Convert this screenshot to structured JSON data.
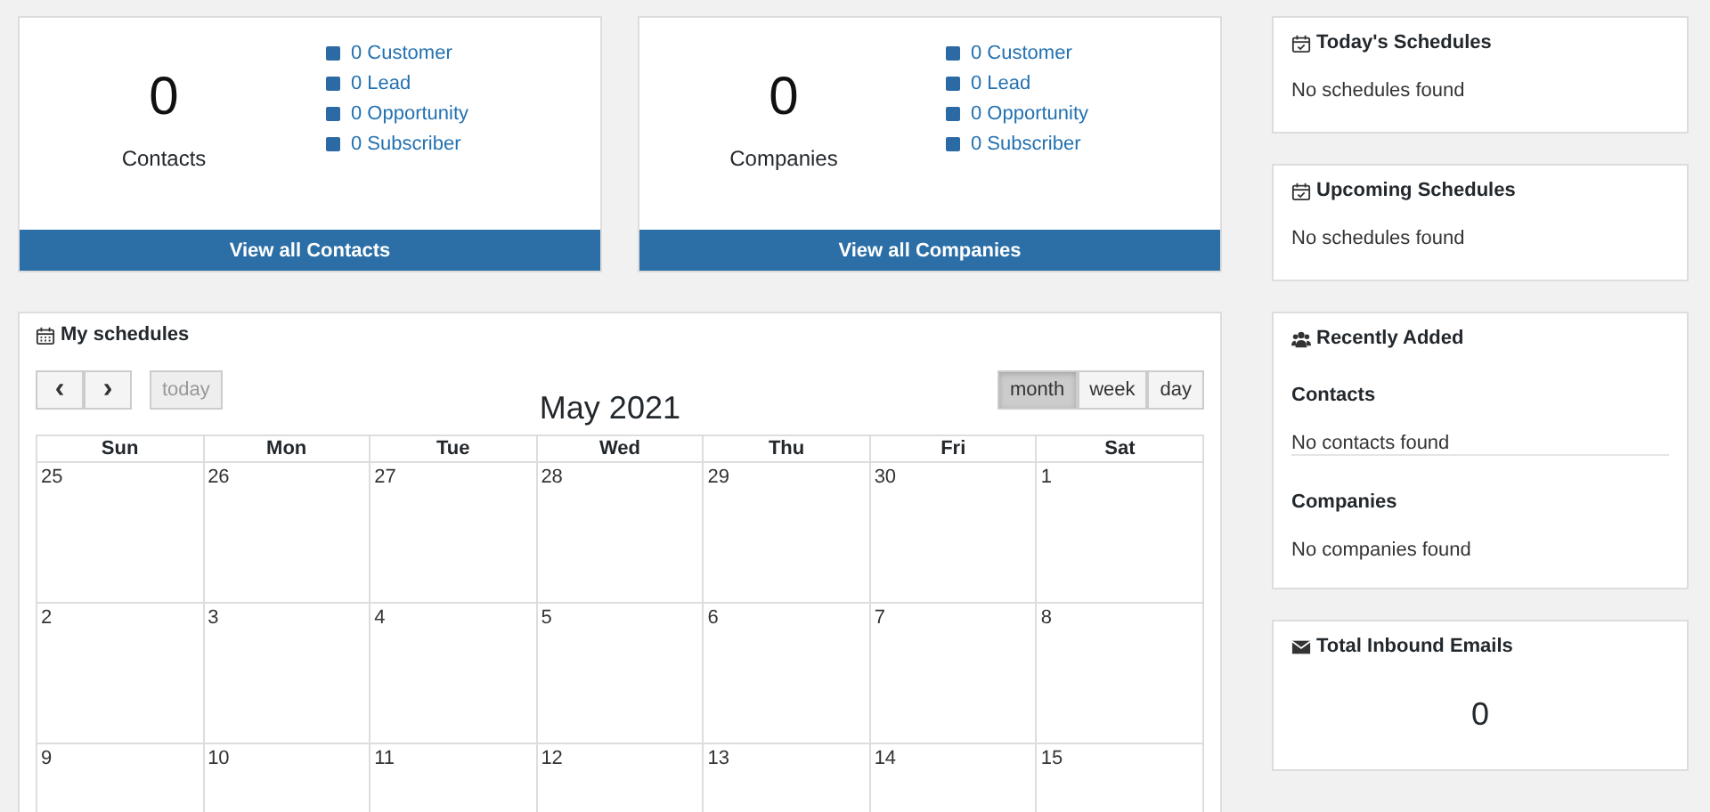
{
  "stat_cards": [
    {
      "count": "0",
      "label": "Contacts",
      "breakdown": [
        "0 Customer",
        "0 Lead",
        "0 Opportunity",
        "0 Subscriber"
      ],
      "button": "View all Contacts"
    },
    {
      "count": "0",
      "label": "Companies",
      "breakdown": [
        "0 Customer",
        "0 Lead",
        "0 Opportunity",
        "0 Subscriber"
      ],
      "button": "View all Companies"
    }
  ],
  "calendar": {
    "title": "My schedules",
    "prev": "‹",
    "next": "›",
    "today": "today",
    "month_title": "May 2021",
    "views": [
      {
        "label": "month",
        "selected": true
      },
      {
        "label": "week",
        "selected": false
      },
      {
        "label": "day",
        "selected": false
      }
    ],
    "weekdays": [
      "Sun",
      "Mon",
      "Tue",
      "Wed",
      "Thu",
      "Fri",
      "Sat"
    ],
    "weeks": [
      [
        "25",
        "26",
        "27",
        "28",
        "29",
        "30",
        "1"
      ],
      [
        "2",
        "3",
        "4",
        "5",
        "6",
        "7",
        "8"
      ],
      [
        "9",
        "10",
        "11",
        "12",
        "13",
        "14",
        "15"
      ]
    ]
  },
  "side_panels": [
    {
      "kind": "schedules",
      "title": "Today's Schedules",
      "message": "No schedules found"
    },
    {
      "kind": "schedules",
      "title": "Upcoming Schedules",
      "message": "No schedules found"
    },
    {
      "kind": "recent",
      "title": "Recently Added",
      "sections": [
        {
          "heading": "Contacts",
          "message": "No contacts found"
        },
        {
          "heading": "Companies",
          "message": "No companies found"
        }
      ]
    },
    {
      "kind": "emails",
      "title": "Total Inbound Emails",
      "count": "0"
    }
  ]
}
